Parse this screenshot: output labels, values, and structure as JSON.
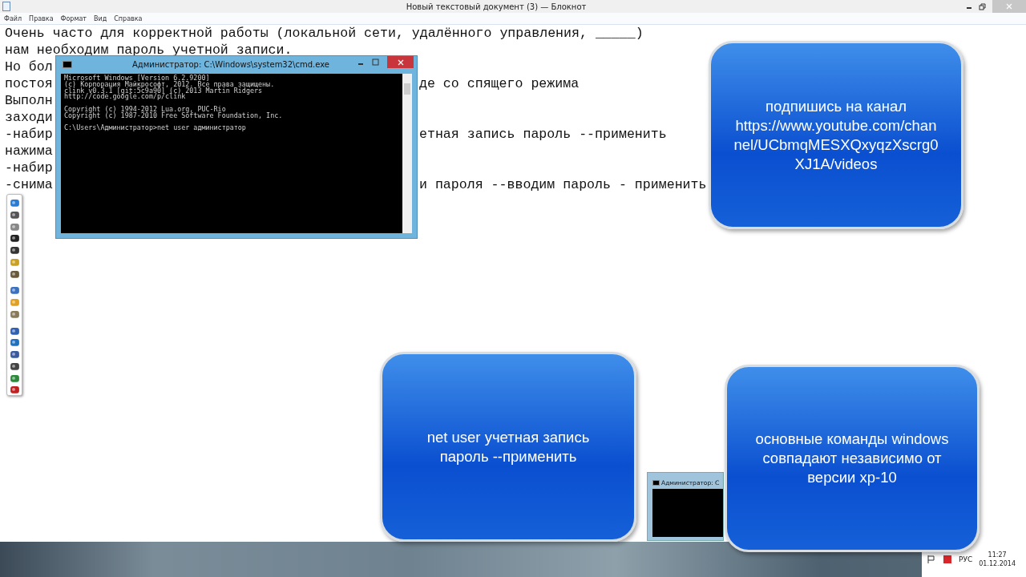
{
  "window": {
    "title": "Новый текстовый документ (3) — Блокнот"
  },
  "menu": [
    "Файл",
    "Правка",
    "Формат",
    "Вид",
    "Справка"
  ],
  "text_lines": [
    {
      "left": "Очень часто для корректной работы (локальной сети, удалённого управления, _____)"
    },
    {
      "left": "нам необходим пароль учетной записи."
    },
    {
      "left": "Но бол"
    },
    {
      "left": "постоя",
      "right": "де со спящего режима"
    },
    {
      "left": "Выполн"
    },
    {
      "left": "заходи"
    },
    {
      "left": "-набир",
      "right": "етная запись пароль --применить"
    },
    {
      "left": "нажима"
    },
    {
      "left": "-набир"
    },
    {
      "left": "-снима",
      "right": "и пароля --вводим пароль - применить"
    }
  ],
  "cmd_window": {
    "title": "Администратор: C:\\Windows\\system32\\cmd.exe",
    "blocks": [
      [
        "Microsoft Windows [Version 6.2.9200]",
        "(c) Корпорация Майкрософт, 2012. Все права защищены.",
        "clink v0.3.1 [git:5c9a90] (c) 2013 Martin Ridgers",
        "http://code.google.com/p/clink"
      ],
      [
        "Copyright (c) 1994-2012 Lua.org, PUC-Rio",
        "Copyright (c) 1987-2010 Free Software Foundation, Inc."
      ],
      [
        "C:\\Users\\Администратор>net user администратор"
      ]
    ]
  },
  "cmd_thumbnail": {
    "title": "Администратор: C"
  },
  "callouts": [
    {
      "lines": [
        "подпишись на канал",
        "https://www.youtube.com/chan",
        "nel/UCbmqMESXQxyqzXscrg0",
        "XJ1A/videos"
      ]
    },
    {
      "lines": [
        "net user учетная запись",
        "пароль --применить"
      ]
    },
    {
      "lines": [
        "основные команды windows",
        "совпадают независимо от",
        "версии xp-10"
      ]
    }
  ],
  "tray": {
    "language": "РУС",
    "time": "11:27",
    "date": "01.12.2014"
  }
}
